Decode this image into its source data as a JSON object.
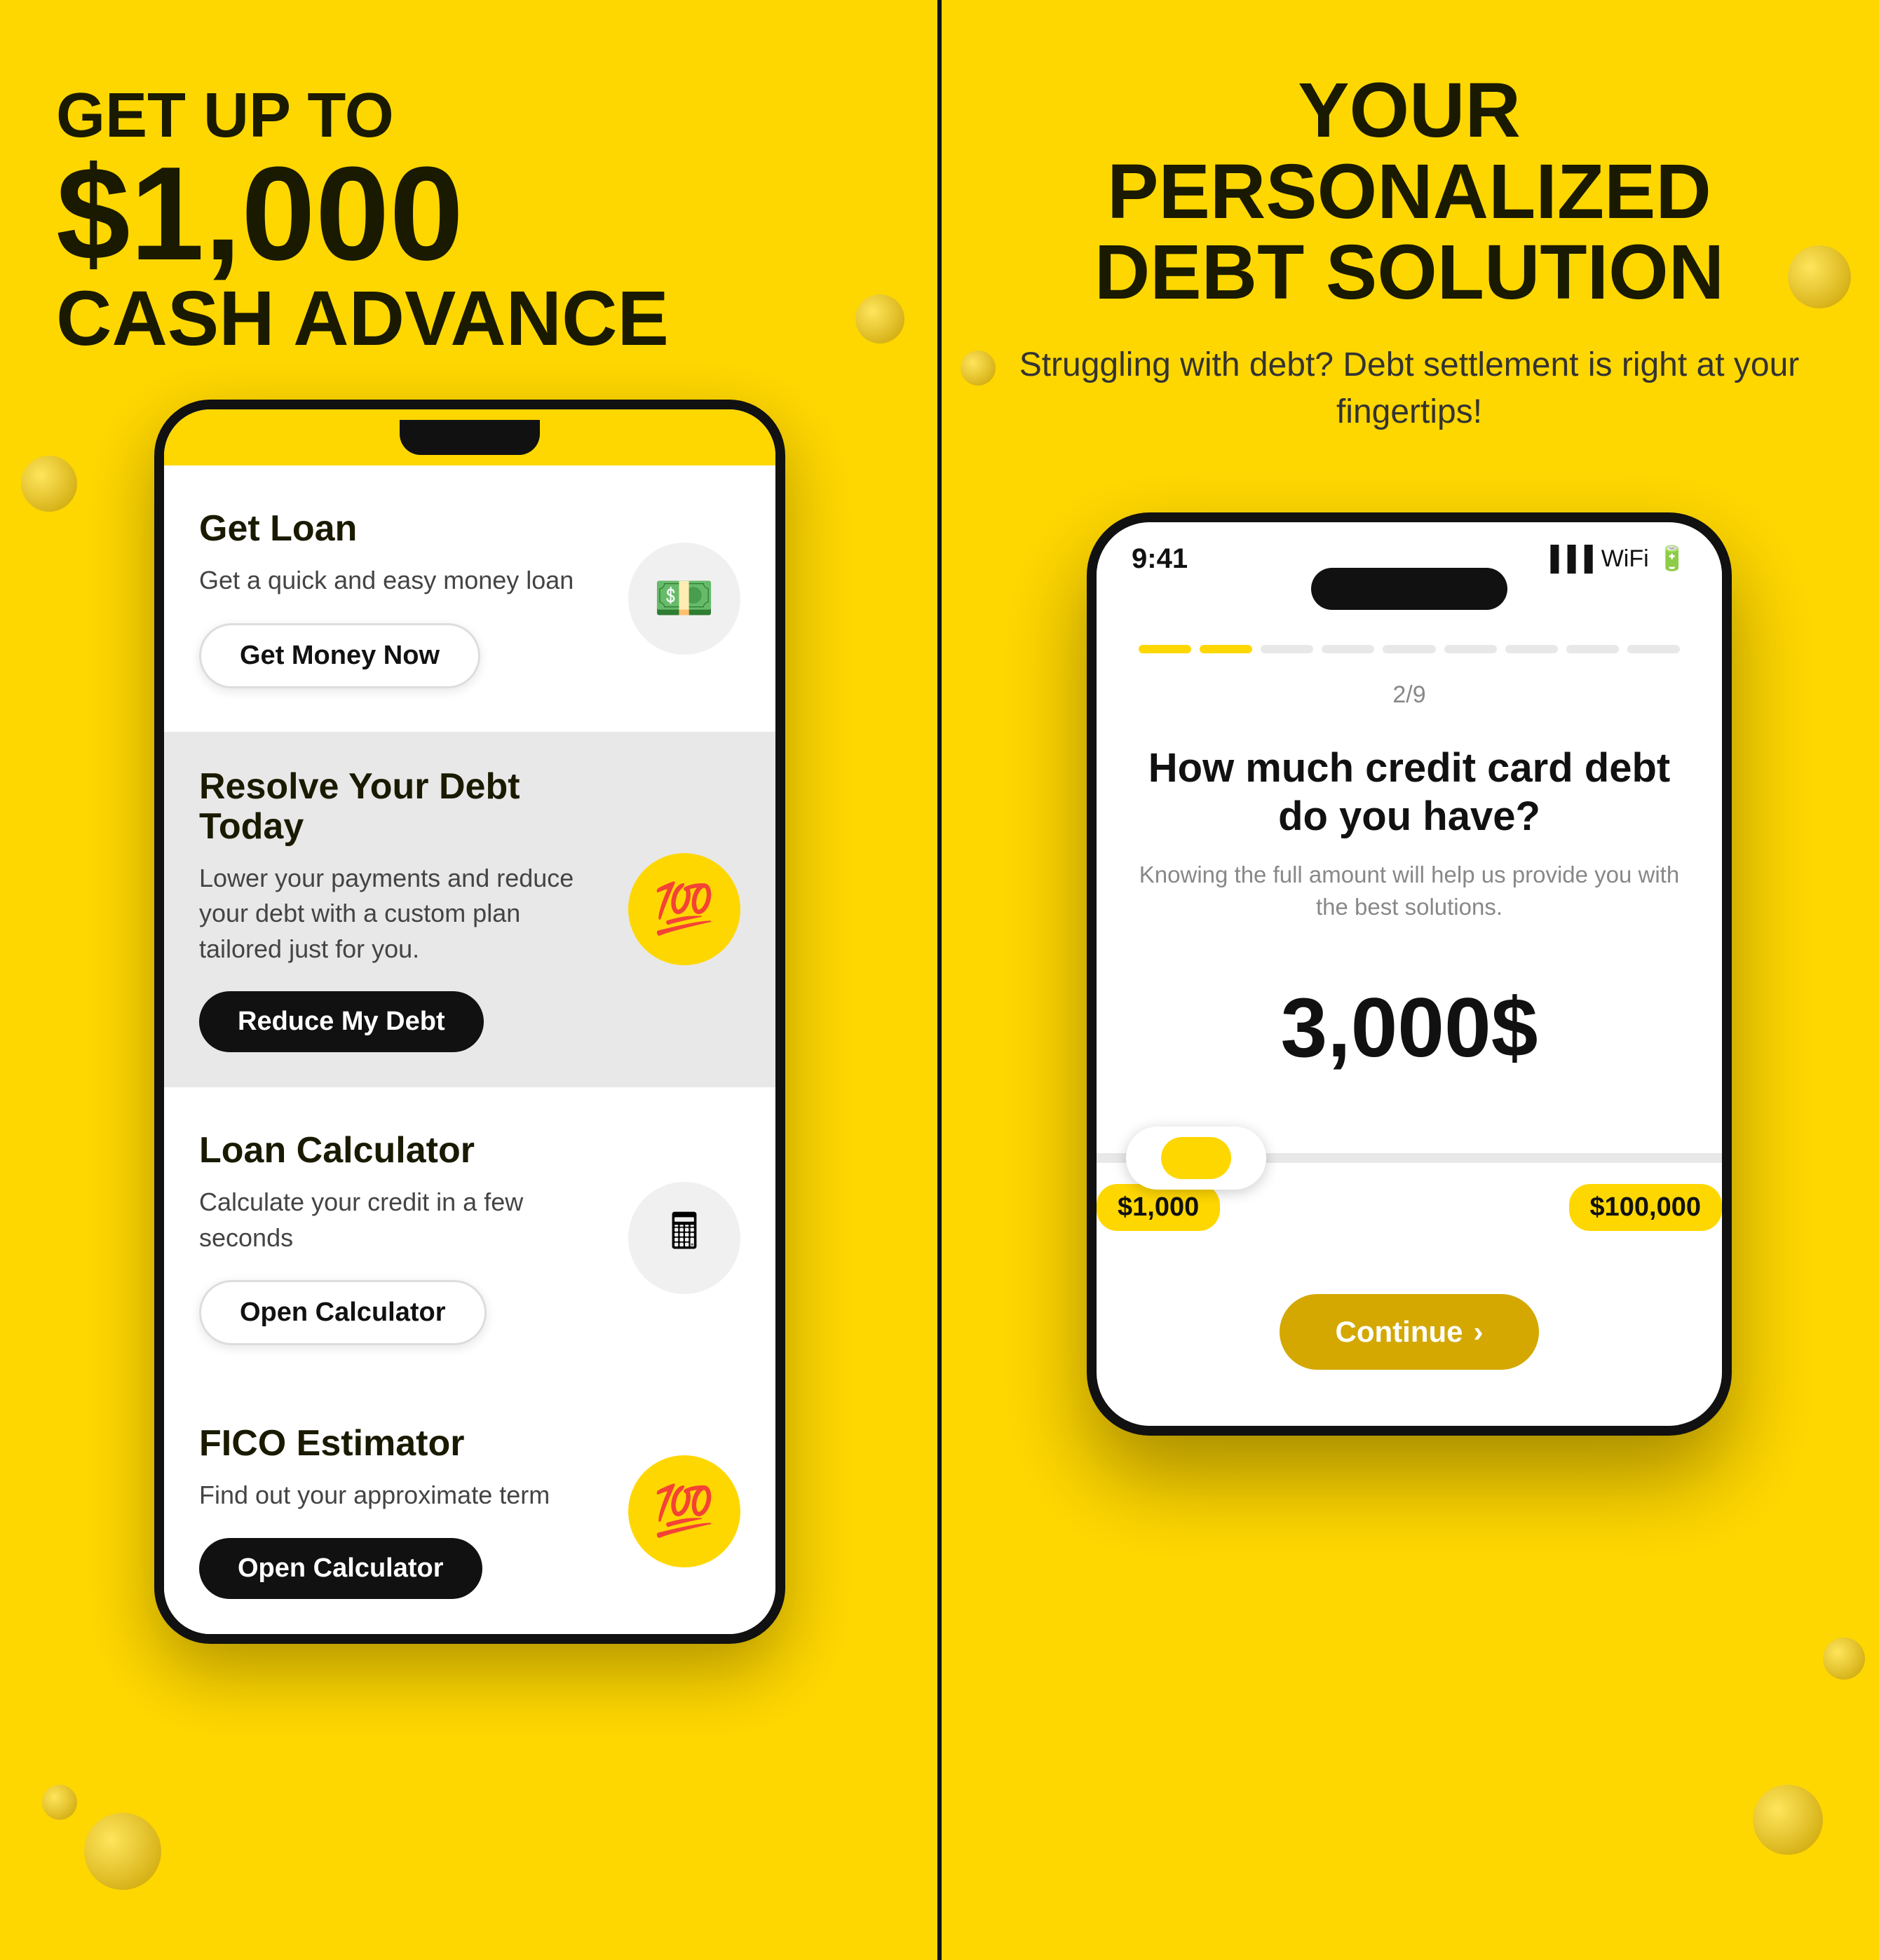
{
  "left": {
    "headline_line1": "GET UP TO",
    "headline_amount": "$1,000",
    "headline_line3": "CASH ADVANCE",
    "cards": [
      {
        "id": "get-loan",
        "title": "Get Loan",
        "desc": "Get a quick and easy money loan",
        "btn_label": "Get Money Now",
        "btn_style": "light",
        "icon": "💵",
        "icon_bg": "light"
      },
      {
        "id": "resolve-debt",
        "title": "Resolve Your Debt Today",
        "desc": "Lower your payments and reduce your debt with a custom plan tailored just for you.",
        "btn_label": "Reduce My Debt",
        "btn_style": "dark",
        "icon": "💯",
        "icon_bg": "yellow"
      },
      {
        "id": "loan-calculator",
        "title": "Loan  Calculator",
        "desc": "Calculate your credit in a few seconds",
        "btn_label": "Open Calculator",
        "btn_style": "light",
        "icon": "🖩",
        "icon_bg": "light"
      },
      {
        "id": "fico-estimator",
        "title": "FICO Estimator",
        "desc": "Find out your approximate term",
        "btn_label": "Open Calculator",
        "btn_style": "dark",
        "icon": "💯",
        "icon_bg": "yellow"
      }
    ]
  },
  "right": {
    "title_line1": "YOUR",
    "title_line2": "PERSONALIZED",
    "title_line3": "DEBT SOLUTION",
    "subtitle": "Struggling with debt? Debt settlement is right at your fingertips!",
    "phone": {
      "status_time": "9:41",
      "step_label": "2/9",
      "question": "How much credit card debt do you have?",
      "question_desc": "Knowing the full amount will help us provide you with the best solutions.",
      "debt_amount": "3,000$",
      "slider_min": "$1,000",
      "slider_max": "$100,000",
      "continue_label": "Continue",
      "continue_arrow": "›"
    }
  }
}
